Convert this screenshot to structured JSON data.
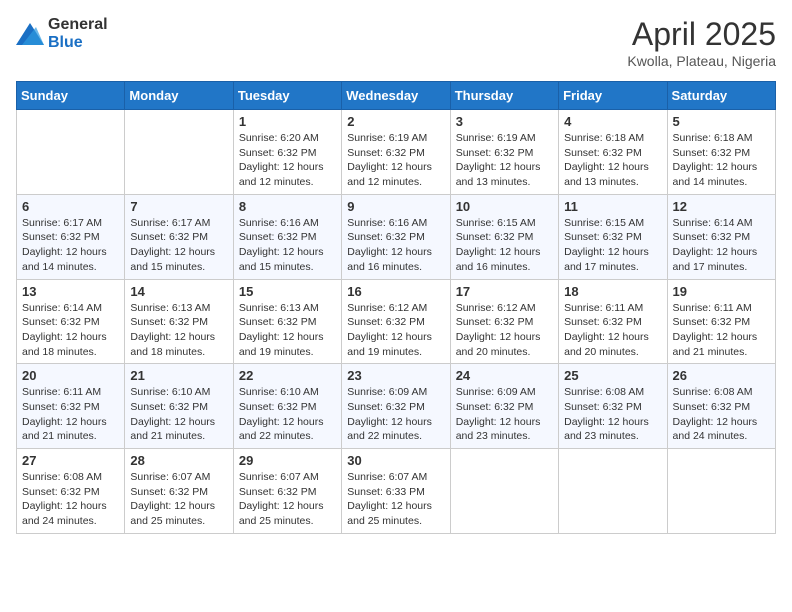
{
  "logo": {
    "general": "General",
    "blue": "Blue"
  },
  "header": {
    "title": "April 2025",
    "subtitle": "Kwolla, Plateau, Nigeria"
  },
  "weekdays": [
    "Sunday",
    "Monday",
    "Tuesday",
    "Wednesday",
    "Thursday",
    "Friday",
    "Saturday"
  ],
  "weeks": [
    [
      {
        "day": "",
        "info": ""
      },
      {
        "day": "",
        "info": ""
      },
      {
        "day": "1",
        "info": "Sunrise: 6:20 AM\nSunset: 6:32 PM\nDaylight: 12 hours and 12 minutes."
      },
      {
        "day": "2",
        "info": "Sunrise: 6:19 AM\nSunset: 6:32 PM\nDaylight: 12 hours and 12 minutes."
      },
      {
        "day": "3",
        "info": "Sunrise: 6:19 AM\nSunset: 6:32 PM\nDaylight: 12 hours and 13 minutes."
      },
      {
        "day": "4",
        "info": "Sunrise: 6:18 AM\nSunset: 6:32 PM\nDaylight: 12 hours and 13 minutes."
      },
      {
        "day": "5",
        "info": "Sunrise: 6:18 AM\nSunset: 6:32 PM\nDaylight: 12 hours and 14 minutes."
      }
    ],
    [
      {
        "day": "6",
        "info": "Sunrise: 6:17 AM\nSunset: 6:32 PM\nDaylight: 12 hours and 14 minutes."
      },
      {
        "day": "7",
        "info": "Sunrise: 6:17 AM\nSunset: 6:32 PM\nDaylight: 12 hours and 15 minutes."
      },
      {
        "day": "8",
        "info": "Sunrise: 6:16 AM\nSunset: 6:32 PM\nDaylight: 12 hours and 15 minutes."
      },
      {
        "day": "9",
        "info": "Sunrise: 6:16 AM\nSunset: 6:32 PM\nDaylight: 12 hours and 16 minutes."
      },
      {
        "day": "10",
        "info": "Sunrise: 6:15 AM\nSunset: 6:32 PM\nDaylight: 12 hours and 16 minutes."
      },
      {
        "day": "11",
        "info": "Sunrise: 6:15 AM\nSunset: 6:32 PM\nDaylight: 12 hours and 17 minutes."
      },
      {
        "day": "12",
        "info": "Sunrise: 6:14 AM\nSunset: 6:32 PM\nDaylight: 12 hours and 17 minutes."
      }
    ],
    [
      {
        "day": "13",
        "info": "Sunrise: 6:14 AM\nSunset: 6:32 PM\nDaylight: 12 hours and 18 minutes."
      },
      {
        "day": "14",
        "info": "Sunrise: 6:13 AM\nSunset: 6:32 PM\nDaylight: 12 hours and 18 minutes."
      },
      {
        "day": "15",
        "info": "Sunrise: 6:13 AM\nSunset: 6:32 PM\nDaylight: 12 hours and 19 minutes."
      },
      {
        "day": "16",
        "info": "Sunrise: 6:12 AM\nSunset: 6:32 PM\nDaylight: 12 hours and 19 minutes."
      },
      {
        "day": "17",
        "info": "Sunrise: 6:12 AM\nSunset: 6:32 PM\nDaylight: 12 hours and 20 minutes."
      },
      {
        "day": "18",
        "info": "Sunrise: 6:11 AM\nSunset: 6:32 PM\nDaylight: 12 hours and 20 minutes."
      },
      {
        "day": "19",
        "info": "Sunrise: 6:11 AM\nSunset: 6:32 PM\nDaylight: 12 hours and 21 minutes."
      }
    ],
    [
      {
        "day": "20",
        "info": "Sunrise: 6:11 AM\nSunset: 6:32 PM\nDaylight: 12 hours and 21 minutes."
      },
      {
        "day": "21",
        "info": "Sunrise: 6:10 AM\nSunset: 6:32 PM\nDaylight: 12 hours and 21 minutes."
      },
      {
        "day": "22",
        "info": "Sunrise: 6:10 AM\nSunset: 6:32 PM\nDaylight: 12 hours and 22 minutes."
      },
      {
        "day": "23",
        "info": "Sunrise: 6:09 AM\nSunset: 6:32 PM\nDaylight: 12 hours and 22 minutes."
      },
      {
        "day": "24",
        "info": "Sunrise: 6:09 AM\nSunset: 6:32 PM\nDaylight: 12 hours and 23 minutes."
      },
      {
        "day": "25",
        "info": "Sunrise: 6:08 AM\nSunset: 6:32 PM\nDaylight: 12 hours and 23 minutes."
      },
      {
        "day": "26",
        "info": "Sunrise: 6:08 AM\nSunset: 6:32 PM\nDaylight: 12 hours and 24 minutes."
      }
    ],
    [
      {
        "day": "27",
        "info": "Sunrise: 6:08 AM\nSunset: 6:32 PM\nDaylight: 12 hours and 24 minutes."
      },
      {
        "day": "28",
        "info": "Sunrise: 6:07 AM\nSunset: 6:32 PM\nDaylight: 12 hours and 25 minutes."
      },
      {
        "day": "29",
        "info": "Sunrise: 6:07 AM\nSunset: 6:32 PM\nDaylight: 12 hours and 25 minutes."
      },
      {
        "day": "30",
        "info": "Sunrise: 6:07 AM\nSunset: 6:33 PM\nDaylight: 12 hours and 25 minutes."
      },
      {
        "day": "",
        "info": ""
      },
      {
        "day": "",
        "info": ""
      },
      {
        "day": "",
        "info": ""
      }
    ]
  ]
}
